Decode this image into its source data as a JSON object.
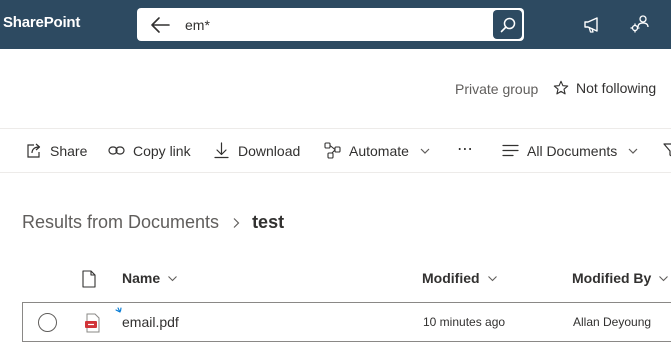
{
  "suitebar": {
    "brand": "SharePoint",
    "search_query": "em*"
  },
  "header": {
    "privacy": "Private group",
    "follow_label": "Not following"
  },
  "commands": {
    "share": "Share",
    "copy_link": "Copy link",
    "download": "Download",
    "automate": "Automate",
    "more": "⋯",
    "view": "All Documents"
  },
  "breadcrumb": {
    "parent": "Results from Documents",
    "current": "test"
  },
  "table": {
    "columns": [
      "Name",
      "Modified",
      "Modified By"
    ],
    "rows": [
      {
        "name": "email.pdf",
        "modified": "10 minutes ago",
        "modified_by": "Allan Deyoung"
      }
    ]
  },
  "colors": {
    "suitebar": "#2d4a61",
    "pdf_icon": "#d13438",
    "new_indicator": "#0078d4"
  }
}
